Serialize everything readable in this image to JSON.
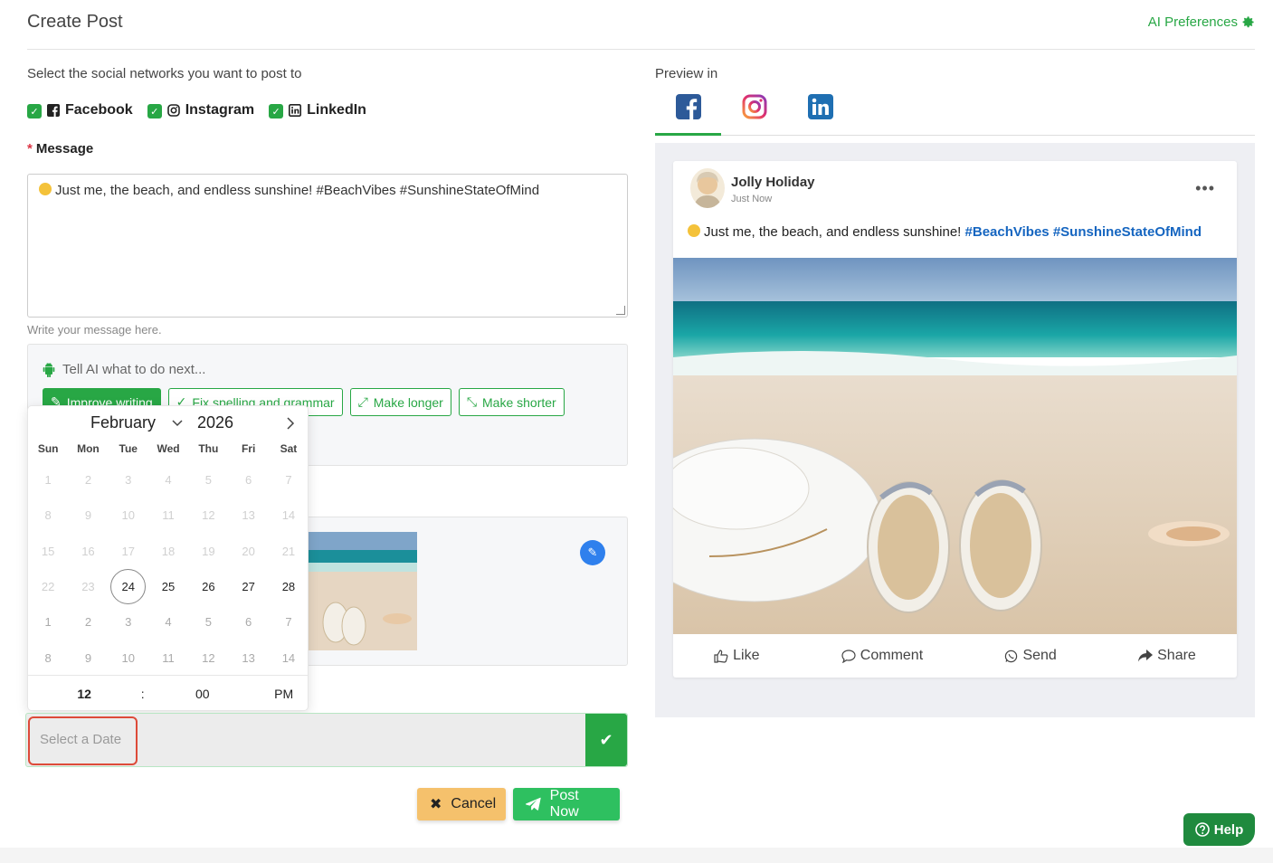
{
  "header": {
    "title": "Create Post",
    "ai_preferences": "AI Preferences"
  },
  "networks": {
    "label": "Select the social networks you want to post to",
    "items": [
      {
        "name": "Facebook",
        "checked": true,
        "icon": "facebook-icon"
      },
      {
        "name": "Instagram",
        "checked": true,
        "icon": "instagram-icon"
      },
      {
        "name": "LinkedIn",
        "checked": true,
        "icon": "linkedin-icon"
      }
    ]
  },
  "message": {
    "required_marker": "*",
    "label": "Message",
    "value": "Just me, the beach, and endless sunshine! #BeachVibes #SunshineStateOfMind",
    "helper": "Write your message here."
  },
  "ai": {
    "prompt_placeholder": "Tell AI what to do next...",
    "buttons": [
      "Improve writing",
      "Fix spelling and grammar",
      "Make longer",
      "Make shorter"
    ]
  },
  "calendar": {
    "month": "February",
    "year": "2026",
    "weekdays": [
      "Sun",
      "Mon",
      "Tue",
      "Wed",
      "Thu",
      "Fri",
      "Sat"
    ],
    "days": [
      [
        "1",
        "2",
        "3",
        "4",
        "5",
        "6",
        "7"
      ],
      [
        "8",
        "9",
        "10",
        "11",
        "12",
        "13",
        "14"
      ],
      [
        "15",
        "16",
        "17",
        "18",
        "19",
        "20",
        "21"
      ],
      [
        "22",
        "23",
        "24",
        "25",
        "26",
        "27",
        "28"
      ],
      [
        "1",
        "2",
        "3",
        "4",
        "5",
        "6",
        "7"
      ],
      [
        "8",
        "9",
        "10",
        "11",
        "12",
        "13",
        "14"
      ]
    ],
    "today": "24",
    "time": {
      "hour": "12",
      "separator": ":",
      "minute": "00",
      "ampm": "PM"
    }
  },
  "schedule": {
    "date_placeholder": "Select a Date"
  },
  "actions": {
    "cancel": "Cancel",
    "post_now": "Post Now"
  },
  "preview": {
    "label": "Preview in",
    "tabs": [
      "facebook-icon",
      "instagram-icon",
      "linkedin-icon"
    ],
    "author": "Jolly Holiday",
    "time": "Just Now",
    "text": "Just me, the beach, and endless sunshine!",
    "hashtags": [
      "#BeachVibes",
      "#SunshineStateOfMind"
    ],
    "actions": [
      "Like",
      "Comment",
      "Send",
      "Share"
    ]
  },
  "help": {
    "label": "Help"
  },
  "colors": {
    "accent": "#28a745",
    "danger": "#dc3545",
    "link": "#1565c0",
    "cancel": "#f5c16c"
  }
}
